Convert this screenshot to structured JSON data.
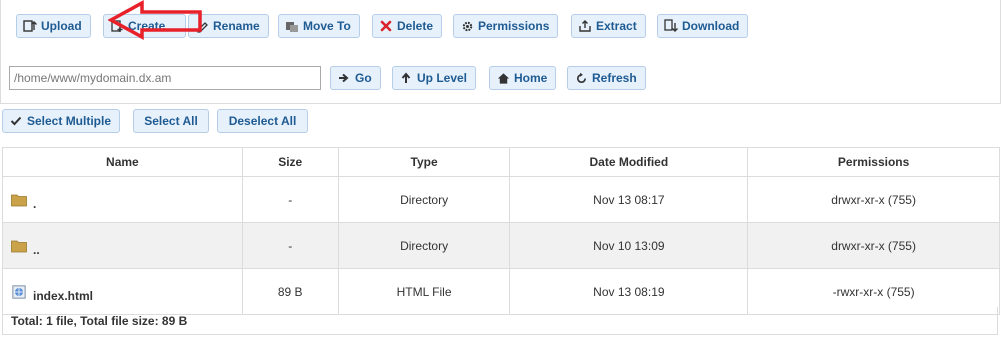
{
  "toolbar": {
    "upload": "Upload",
    "create": "Create",
    "rename": "Rename",
    "move_to": "Move To",
    "delete": "Delete",
    "permissions": "Permissions",
    "extract": "Extract",
    "download": "Download"
  },
  "nav": {
    "path_value": "/home/www/mydomain.dx.am",
    "go": "Go",
    "up_level": "Up Level",
    "home": "Home",
    "refresh": "Refresh"
  },
  "select": {
    "multiple": "Select Multiple",
    "all": "Select All",
    "none": "Deselect All"
  },
  "table": {
    "headers": [
      "Name",
      "Size",
      "Type",
      "Date Modified",
      "Permissions"
    ],
    "rows": [
      {
        "name": ".",
        "size": "-",
        "type": "Directory",
        "date": "Nov 13 08:17",
        "perms": "drwxr-xr-x (755)",
        "icon": "folder-icon"
      },
      {
        "name": "..",
        "size": "-",
        "type": "Directory",
        "date": "Nov 10 13:09",
        "perms": "drwxr-xr-x (755)",
        "icon": "folder-icon"
      },
      {
        "name": "index.html",
        "size": "89 B",
        "type": "HTML File",
        "date": "Nov 13 08:19",
        "perms": "-rwxr-xr-x (755)",
        "icon": "html-file-icon"
      }
    ]
  },
  "footer": "Total: 1 file, Total file size: 89 B",
  "colors": {
    "button_bg": "#e7f1fb",
    "button_border": "#b5cde6",
    "button_text": "#1f5b93",
    "annotation_arrow": "#e8202a",
    "delete_icon": "#d9232d"
  }
}
